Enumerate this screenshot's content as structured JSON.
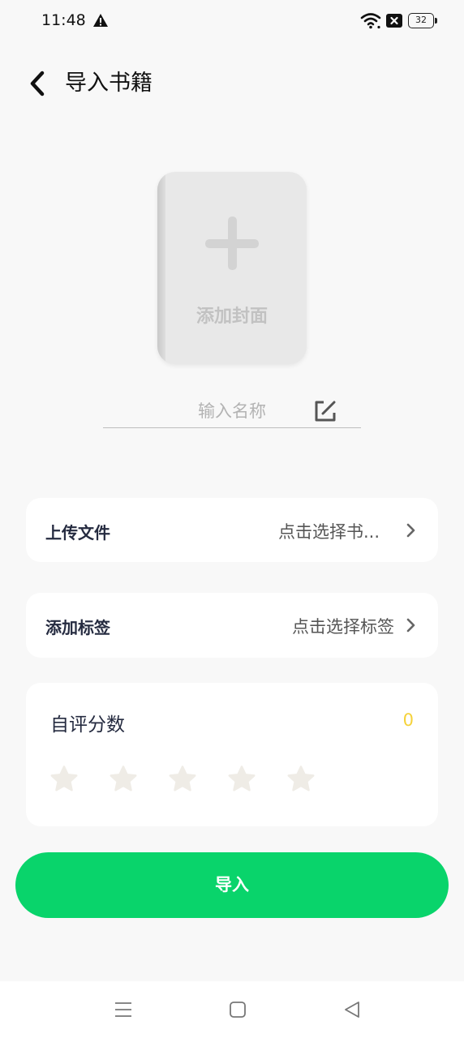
{
  "status_bar": {
    "time": "11:48",
    "battery": "32",
    "icons": [
      "warning-icon",
      "wifi-icon",
      "close-box-icon",
      "battery-icon"
    ]
  },
  "header": {
    "title": "导入书籍",
    "back_icon": "chevron-left-icon"
  },
  "cover": {
    "label": "添加封面",
    "icon": "plus-icon"
  },
  "name_field": {
    "placeholder": "输入名称",
    "value": "",
    "icon": "edit-icon"
  },
  "upload": {
    "label": "上传文件",
    "value": "点击选择书..."
  },
  "tags": {
    "label": "添加标签",
    "value": "点击选择标签"
  },
  "rating": {
    "title": "自评分数",
    "score": "0",
    "stars_total": 5,
    "stars_filled": 0
  },
  "import_button": {
    "label": "导入"
  },
  "colors": {
    "accent_green": "#09d46b",
    "score_yellow": "#f5d23a",
    "star_empty": "#efece6",
    "background": "#f8f8f8"
  },
  "nav_bar": {
    "icons": [
      "menu-icon",
      "home-icon",
      "back-icon"
    ]
  }
}
